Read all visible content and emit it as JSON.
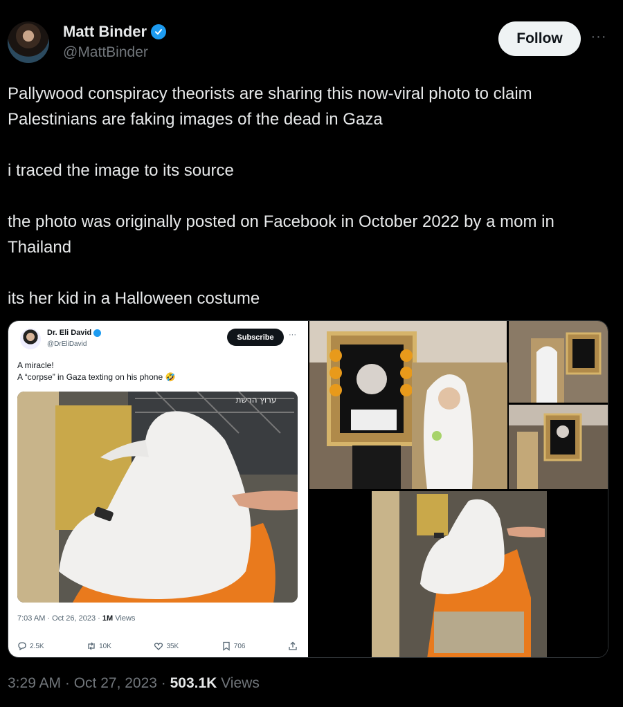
{
  "author": {
    "name": "Matt Binder",
    "handle": "@MattBinder",
    "verified": true
  },
  "actions": {
    "follow_label": "Follow",
    "more_label": "···"
  },
  "tweet": {
    "paragraphs": [
      "Pallywood conspiracy theorists are sharing this now-viral photo to claim Palestinians are faking images of the dead in Gaza",
      "i traced the image to its source",
      "the photo was originally posted on Facebook in October 2022 by a mom in Thailand",
      "its her kid in a Halloween costume"
    ]
  },
  "embedded": {
    "name": "Dr. Eli David",
    "handle": "@DrEliDavid",
    "subscribe_label": "Subscribe",
    "more_label": "···",
    "text_line1": "A miracle!",
    "text_line2": "A “corpse” in Gaza texting on his phone 🤣",
    "meta_time": "7:03 AM · Oct 26, 2023 · ",
    "meta_views": "1M",
    "meta_views_label": " Views",
    "image_text": "ערוץ הרשת",
    "counts": {
      "replies": "2.5K",
      "retweets": "10K",
      "likes": "35K",
      "bookmarks": "706"
    }
  },
  "footer": {
    "time": "3:29 AM · Oct 27, 2023 · ",
    "views": "503.1K",
    "views_label": " Views"
  },
  "colors": {
    "background": "#000000",
    "text": "#e7e9ea",
    "muted": "#71767b",
    "verified": "#1d9bf0",
    "follow_bg": "#eff3f4"
  }
}
